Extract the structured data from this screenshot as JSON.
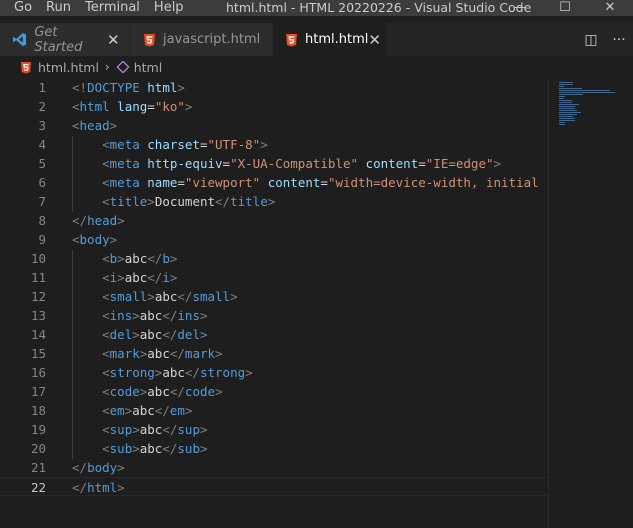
{
  "menu": [
    "Go",
    "Run",
    "Terminal",
    "Help"
  ],
  "window": {
    "title": "html.html - HTML 20220226 - Visual Studio Code",
    "minimize_glyph": "—",
    "maximize_glyph": "☐",
    "close_glyph": "✕"
  },
  "tabs": [
    {
      "label": "Get Started",
      "icon": "vscode-icon",
      "italic": true,
      "active": false,
      "close": "✕"
    },
    {
      "label": "javascript.html",
      "icon": "html5-icon",
      "italic": false,
      "active": false,
      "close": ""
    },
    {
      "label": "html.html",
      "icon": "html5-icon",
      "italic": false,
      "active": true,
      "close": "✕"
    }
  ],
  "tab_actions": {
    "split": "◫",
    "more": "···"
  },
  "breadcrumb": {
    "file": "html.html",
    "symbol": "html",
    "separator": "›"
  },
  "editor": {
    "current_line": 22,
    "lines": [
      {
        "n": "1",
        "tokens": [
          [
            "t",
            "<!"
          ],
          [
            "tg",
            "DOCTYPE "
          ],
          [
            "at",
            "html"
          ],
          [
            "t",
            ">"
          ]
        ]
      },
      {
        "n": "2",
        "tokens": [
          [
            "t",
            "<"
          ],
          [
            "tg",
            "html"
          ],
          [
            "tx",
            " "
          ],
          [
            "at",
            "lang"
          ],
          [
            "tx",
            "="
          ],
          [
            "sv",
            "\"ko\""
          ],
          [
            "t",
            ">"
          ]
        ]
      },
      {
        "n": "3",
        "tokens": [
          [
            "t",
            "<"
          ],
          [
            "tg",
            "head"
          ],
          [
            "t",
            ">"
          ]
        ]
      },
      {
        "n": "4",
        "tokens": [
          [
            "tx",
            "    "
          ],
          [
            "t",
            "<"
          ],
          [
            "tg",
            "meta"
          ],
          [
            "tx",
            " "
          ],
          [
            "at",
            "charset"
          ],
          [
            "tx",
            "="
          ],
          [
            "sv",
            "\"UTF-8\""
          ],
          [
            "t",
            ">"
          ]
        ]
      },
      {
        "n": "5",
        "tokens": [
          [
            "tx",
            "    "
          ],
          [
            "t",
            "<"
          ],
          [
            "tg",
            "meta"
          ],
          [
            "tx",
            " "
          ],
          [
            "at",
            "http-equiv"
          ],
          [
            "tx",
            "="
          ],
          [
            "sv",
            "\"X-UA-Compatible\""
          ],
          [
            "tx",
            " "
          ],
          [
            "at",
            "content"
          ],
          [
            "tx",
            "="
          ],
          [
            "sv",
            "\"IE=edge\""
          ],
          [
            "t",
            ">"
          ]
        ]
      },
      {
        "n": "6",
        "tokens": [
          [
            "tx",
            "    "
          ],
          [
            "t",
            "<"
          ],
          [
            "tg",
            "meta"
          ],
          [
            "tx",
            " "
          ],
          [
            "at",
            "name"
          ],
          [
            "tx",
            "="
          ],
          [
            "sv",
            "\"viewport\""
          ],
          [
            "tx",
            " "
          ],
          [
            "at",
            "content"
          ],
          [
            "tx",
            "="
          ],
          [
            "sv",
            "\"width=device-width, initial"
          ]
        ]
      },
      {
        "n": "7",
        "tokens": [
          [
            "tx",
            "    "
          ],
          [
            "t",
            "<"
          ],
          [
            "tg",
            "title"
          ],
          [
            "t",
            ">"
          ],
          [
            "tx",
            "Document"
          ],
          [
            "t",
            "</"
          ],
          [
            "tg",
            "title"
          ],
          [
            "t",
            ">"
          ]
        ]
      },
      {
        "n": "8",
        "tokens": [
          [
            "t",
            "</"
          ],
          [
            "tg",
            "head"
          ],
          [
            "t",
            ">"
          ]
        ]
      },
      {
        "n": "9",
        "tokens": [
          [
            "t",
            "<"
          ],
          [
            "tg",
            "body"
          ],
          [
            "t",
            ">"
          ]
        ]
      },
      {
        "n": "10",
        "tokens": [
          [
            "tx",
            "    "
          ],
          [
            "t",
            "<"
          ],
          [
            "tg",
            "b"
          ],
          [
            "t",
            ">"
          ],
          [
            "tx",
            "abc"
          ],
          [
            "t",
            "</"
          ],
          [
            "tg",
            "b"
          ],
          [
            "t",
            ">"
          ]
        ]
      },
      {
        "n": "11",
        "tokens": [
          [
            "tx",
            "    "
          ],
          [
            "t",
            "<"
          ],
          [
            "tg",
            "i"
          ],
          [
            "t",
            ">"
          ],
          [
            "tx",
            "abc"
          ],
          [
            "t",
            "</"
          ],
          [
            "tg",
            "i"
          ],
          [
            "t",
            ">"
          ]
        ]
      },
      {
        "n": "12",
        "tokens": [
          [
            "tx",
            "    "
          ],
          [
            "t",
            "<"
          ],
          [
            "tg",
            "small"
          ],
          [
            "t",
            ">"
          ],
          [
            "tx",
            "abc"
          ],
          [
            "t",
            "</"
          ],
          [
            "tg",
            "small"
          ],
          [
            "t",
            ">"
          ]
        ]
      },
      {
        "n": "13",
        "tokens": [
          [
            "tx",
            "    "
          ],
          [
            "t",
            "<"
          ],
          [
            "tg",
            "ins"
          ],
          [
            "t",
            ">"
          ],
          [
            "tx",
            "abc"
          ],
          [
            "t",
            "</"
          ],
          [
            "tg",
            "ins"
          ],
          [
            "t",
            ">"
          ]
        ]
      },
      {
        "n": "14",
        "tokens": [
          [
            "tx",
            "    "
          ],
          [
            "t",
            "<"
          ],
          [
            "tg",
            "del"
          ],
          [
            "t",
            ">"
          ],
          [
            "tx",
            "abc"
          ],
          [
            "t",
            "</"
          ],
          [
            "tg",
            "del"
          ],
          [
            "t",
            ">"
          ]
        ]
      },
      {
        "n": "15",
        "tokens": [
          [
            "tx",
            "    "
          ],
          [
            "t",
            "<"
          ],
          [
            "tg",
            "mark"
          ],
          [
            "t",
            ">"
          ],
          [
            "tx",
            "abc"
          ],
          [
            "t",
            "</"
          ],
          [
            "tg",
            "mark"
          ],
          [
            "t",
            ">"
          ]
        ]
      },
      {
        "n": "16",
        "tokens": [
          [
            "tx",
            "    "
          ],
          [
            "t",
            "<"
          ],
          [
            "tg",
            "strong"
          ],
          [
            "t",
            ">"
          ],
          [
            "tx",
            "abc"
          ],
          [
            "t",
            "</"
          ],
          [
            "tg",
            "strong"
          ],
          [
            "t",
            ">"
          ]
        ]
      },
      {
        "n": "17",
        "tokens": [
          [
            "tx",
            "    "
          ],
          [
            "t",
            "<"
          ],
          [
            "tg",
            "code"
          ],
          [
            "t",
            ">"
          ],
          [
            "tx",
            "abc"
          ],
          [
            "t",
            "</"
          ],
          [
            "tg",
            "code"
          ],
          [
            "t",
            ">"
          ]
        ]
      },
      {
        "n": "18",
        "tokens": [
          [
            "tx",
            "    "
          ],
          [
            "t",
            "<"
          ],
          [
            "tg",
            "em"
          ],
          [
            "t",
            ">"
          ],
          [
            "tx",
            "abc"
          ],
          [
            "t",
            "</"
          ],
          [
            "tg",
            "em"
          ],
          [
            "t",
            ">"
          ]
        ]
      },
      {
        "n": "19",
        "tokens": [
          [
            "tx",
            "    "
          ],
          [
            "t",
            "<"
          ],
          [
            "tg",
            "sup"
          ],
          [
            "t",
            ">"
          ],
          [
            "tx",
            "abc"
          ],
          [
            "t",
            "</"
          ],
          [
            "tg",
            "sup"
          ],
          [
            "t",
            ">"
          ]
        ]
      },
      {
        "n": "20",
        "tokens": [
          [
            "tx",
            "    "
          ],
          [
            "t",
            "<"
          ],
          [
            "tg",
            "sub"
          ],
          [
            "t",
            ">"
          ],
          [
            "tx",
            "abc"
          ],
          [
            "t",
            "</"
          ],
          [
            "tg",
            "sub"
          ],
          [
            "t",
            ">"
          ]
        ]
      },
      {
        "n": "21",
        "tokens": [
          [
            "t",
            "</"
          ],
          [
            "tg",
            "body"
          ],
          [
            "t",
            ">"
          ]
        ]
      },
      {
        "n": "22",
        "tokens": [
          [
            "t",
            "</"
          ],
          [
            "tg",
            "html"
          ],
          [
            "t",
            ">"
          ]
        ]
      }
    ]
  },
  "colors": {
    "tag_bracket": "#808080",
    "tag_name": "#569cd6",
    "attribute": "#9cdcfe",
    "string": "#ce9178",
    "text": "#d4d4d4",
    "html_icon": "#e44d26",
    "vscode_icon": "#3b9fe8"
  }
}
